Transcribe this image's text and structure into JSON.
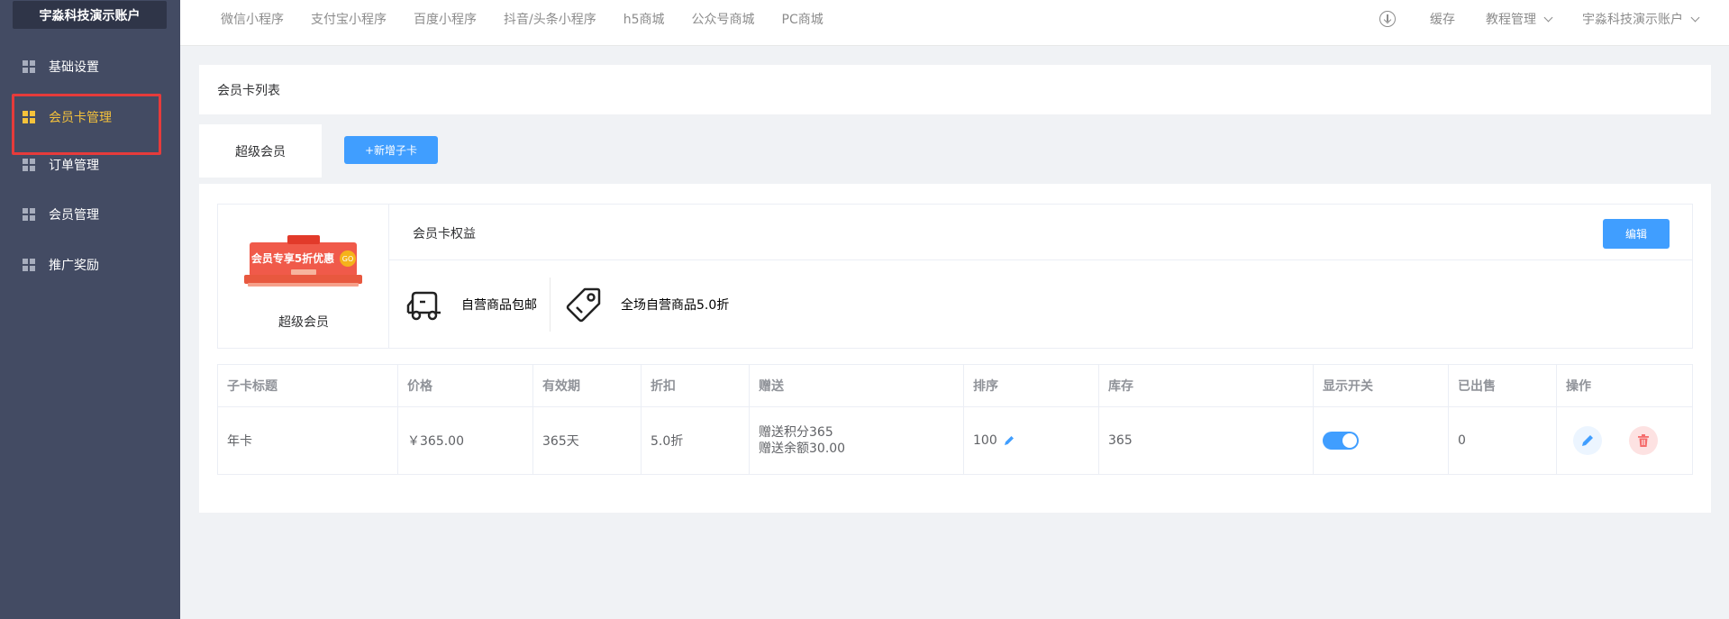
{
  "sidebar": {
    "account": "宇淼科技演示账户",
    "items": [
      {
        "label": "基础设置"
      },
      {
        "label": "会员卡管理"
      },
      {
        "label": "订单管理"
      },
      {
        "label": "会员管理"
      },
      {
        "label": "推广奖励"
      }
    ],
    "active_index": 1,
    "accent_color": "#f5c23b",
    "highlight_color": "#e63b3b"
  },
  "topbar": {
    "nav": [
      "微信小程序",
      "支付宝小程序",
      "百度小程序",
      "抖音/头条小程序",
      "h5商城",
      "公众号商城",
      "PC商城"
    ],
    "download_icon": "download-icon",
    "cache": "缓存",
    "tutorial": "教程管理",
    "account": "宇淼科技演示账户"
  },
  "page": {
    "title": "会员卡列表",
    "tab": "超级会员",
    "add_button": "+新增子卡"
  },
  "card": {
    "name": "超级会员",
    "image_text": "会员专享5折优惠",
    "rights_title": "会员卡权益",
    "edit_button": "编辑",
    "benefits": [
      {
        "icon": "delivery-truck-icon",
        "label": "自营商品包邮"
      },
      {
        "icon": "price-tag-icon",
        "label": "全场自营商品5.0折"
      }
    ]
  },
  "table": {
    "columns": [
      "子卡标题",
      "价格",
      "有效期",
      "折扣",
      "赠送",
      "排序",
      "库存",
      "显示开关",
      "已出售",
      "操作"
    ],
    "rows": [
      {
        "title": "年卡",
        "price": "￥365.00",
        "validity": "365天",
        "discount": "5.0折",
        "gift_points": "赠送积分365",
        "gift_balance": "赠送余额30.00",
        "sort": "100",
        "stock": "365",
        "visible": true,
        "sold": "0"
      }
    ]
  },
  "colors": {
    "primary": "#409eff",
    "danger": "#f56c6c",
    "sidebar_bg": "#434b63"
  }
}
